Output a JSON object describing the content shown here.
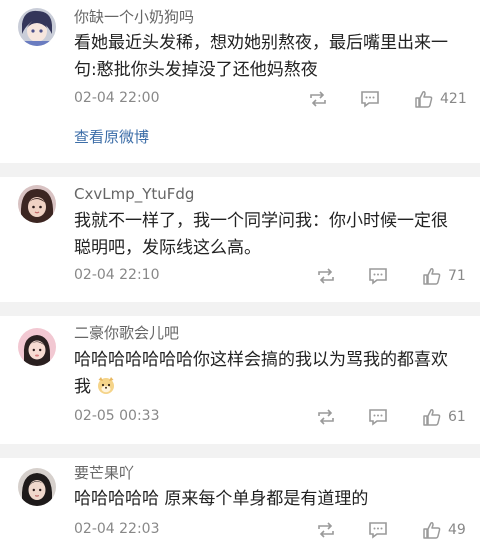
{
  "comments": [
    {
      "username": "你缺一个小奶狗吗",
      "text": "看她最近头发稀，想劝她别熬夜，最后嘴里出来一句:憨批你头发掉没了还他妈熬夜",
      "time": "02-04 22:00",
      "likes": "421",
      "view_original": "查看原微博"
    },
    {
      "username": "CxvLmp_YtuFdg",
      "text": "我就不一样了，我一个同学问我：你小时候一定很聪明吧，发际线这么高。",
      "time": "02-04 22:10",
      "likes": "71"
    },
    {
      "username": "二豪你歌会儿吧",
      "text": "哈哈哈哈哈哈哈你这样会搞的我以为骂我的都喜欢我",
      "time": "02-05 00:33",
      "likes": "61"
    },
    {
      "username": "要芒果吖",
      "text": "哈哈哈哈哈 原来每个单身都是有道理的",
      "time": "02-04 22:03",
      "likes": "49"
    }
  ],
  "icons": {
    "repost": "repost-icon",
    "comment": "comment-icon",
    "like": "thumbs-up-icon",
    "emoji": "dog-face-emoji"
  }
}
